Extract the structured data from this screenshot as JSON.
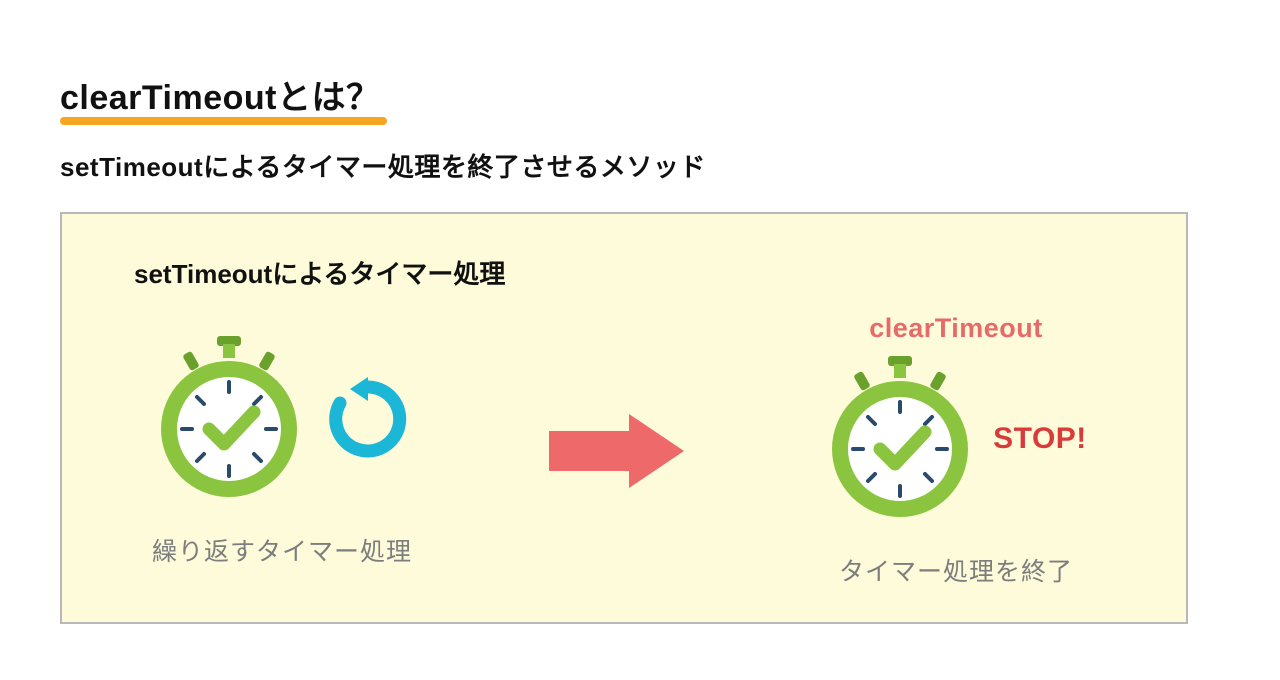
{
  "title": "clearTimeoutとは？",
  "subtitle": "setTimeoutによるタイマー処理を終了させるメソッド",
  "panel": {
    "heading": "setTimeoutによるタイマー処理",
    "left_caption": "繰り返すタイマー処理",
    "right_header": "clearTimeout",
    "right_caption": "タイマー処理を終了",
    "stop_label": "STOP!"
  },
  "colors": {
    "accent_underline": "#f5a623",
    "panel_bg": "#fdfbda",
    "panel_border": "#b8b8b8",
    "stopwatch_green": "#8bc53f",
    "stopwatch_dark": "#6aa02c",
    "loop_cyan": "#1cb6d6",
    "arrow_red": "#ee6a6a",
    "text_red": "#d93a3a",
    "text_salmon": "#e76a6a",
    "caption_grey": "#7d7d7d"
  }
}
